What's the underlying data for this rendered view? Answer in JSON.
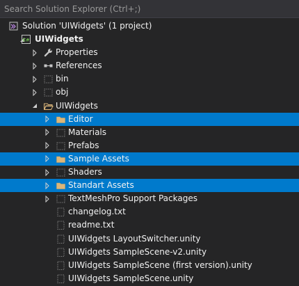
{
  "search": {
    "placeholder": "Search Solution Explorer (Ctrl+;)"
  },
  "tree": [
    {
      "label": "Solution 'UIWidgets' (1 project)",
      "depth": 0,
      "arrow": "none",
      "icon": "solution-icon",
      "name": "tree-item-solution"
    },
    {
      "label": "UIWidgets",
      "depth": 0,
      "arrow": "expanded",
      "icon": "csharp-project-icon",
      "name": "tree-item-project",
      "bold": true
    },
    {
      "label": "Properties",
      "depth": 1,
      "arrow": "collapsed",
      "icon": "wrench-icon",
      "name": "tree-item-properties"
    },
    {
      "label": "References",
      "depth": 1,
      "arrow": "collapsed",
      "icon": "references-icon",
      "name": "tree-item-references"
    },
    {
      "label": "bin",
      "depth": 1,
      "arrow": "collapsed",
      "icon": "dotted-folder-icon",
      "name": "tree-item-bin"
    },
    {
      "label": "obj",
      "depth": 1,
      "arrow": "collapsed",
      "icon": "dotted-folder-icon",
      "name": "tree-item-obj"
    },
    {
      "label": "UIWidgets",
      "depth": 1,
      "arrow": "expanded",
      "icon": "open-folder-icon",
      "name": "tree-item-uiwidgets-folder"
    },
    {
      "label": "Editor",
      "depth": 2,
      "arrow": "collapsed",
      "icon": "folder-icon",
      "name": "tree-item-editor",
      "selected": true
    },
    {
      "label": "Materials",
      "depth": 2,
      "arrow": "collapsed",
      "icon": "dotted-folder-icon",
      "name": "tree-item-materials"
    },
    {
      "label": "Prefabs",
      "depth": 2,
      "arrow": "collapsed",
      "icon": "dotted-folder-icon",
      "name": "tree-item-prefabs"
    },
    {
      "label": "Sample Assets",
      "depth": 2,
      "arrow": "collapsed",
      "icon": "folder-icon",
      "name": "tree-item-sample-assets",
      "selected": true
    },
    {
      "label": "Shaders",
      "depth": 2,
      "arrow": "collapsed",
      "icon": "dotted-folder-icon",
      "name": "tree-item-shaders"
    },
    {
      "label": "Standart Assets",
      "depth": 2,
      "arrow": "collapsed",
      "icon": "folder-icon",
      "name": "tree-item-standart-assets",
      "selected": true
    },
    {
      "label": "TextMeshPro Support Packages",
      "depth": 2,
      "arrow": "collapsed",
      "icon": "dotted-folder-icon",
      "name": "tree-item-textmeshpro"
    },
    {
      "label": "changelog.txt",
      "depth": 2,
      "arrow": "none",
      "icon": "dotted-file-icon",
      "name": "tree-item-changelog"
    },
    {
      "label": "readme.txt",
      "depth": 2,
      "arrow": "none",
      "icon": "dotted-file-icon",
      "name": "tree-item-readme"
    },
    {
      "label": "UIWidgets LayoutSwitcher.unity",
      "depth": 2,
      "arrow": "none",
      "icon": "dotted-file-icon",
      "name": "tree-item-layoutswitcher"
    },
    {
      "label": "UIWidgets SampleScene-v2.unity",
      "depth": 2,
      "arrow": "none",
      "icon": "dotted-file-icon",
      "name": "tree-item-samplescene-v2"
    },
    {
      "label": "UIWidgets SampleScene (first version).unity",
      "depth": 2,
      "arrow": "none",
      "icon": "dotted-file-icon",
      "name": "tree-item-samplescene-first"
    },
    {
      "label": "UIWidgets SampleScene.unity",
      "depth": 2,
      "arrow": "none",
      "icon": "dotted-file-icon",
      "name": "tree-item-samplescene"
    }
  ],
  "colors": {
    "background": "#252526",
    "selection": "#007acc",
    "folder": "#dcb67a",
    "text": "#f1f1f1"
  }
}
